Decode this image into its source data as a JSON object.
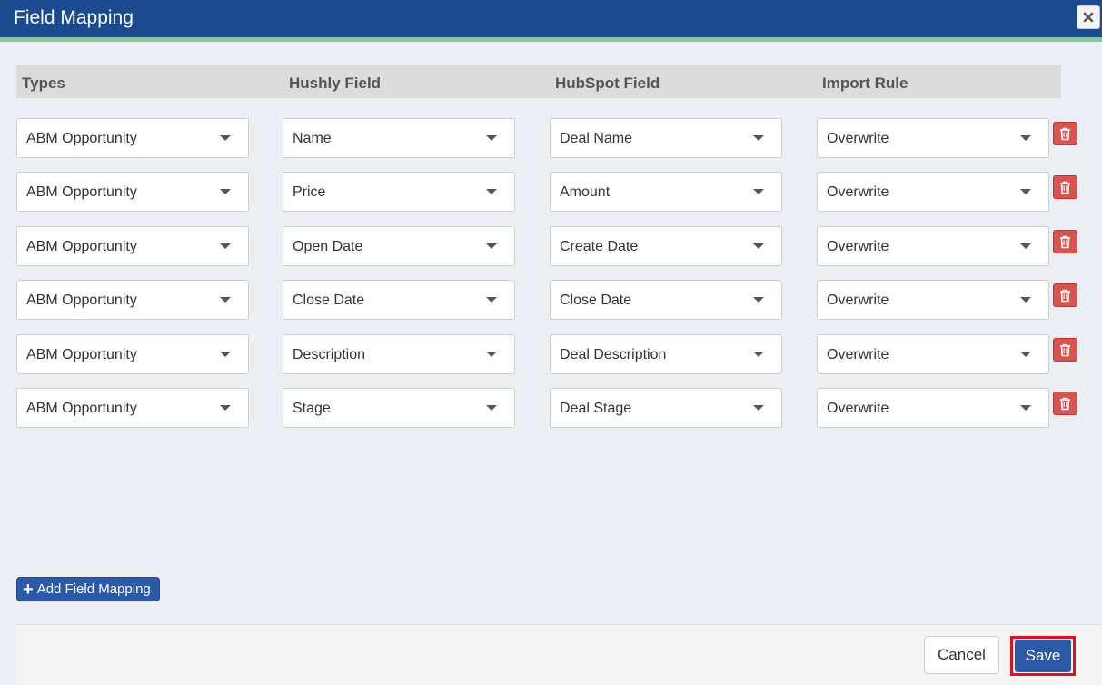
{
  "dialog": {
    "title": "Field Mapping",
    "close_icon": "close-icon"
  },
  "columns": {
    "types": "Types",
    "hushly_field": "Hushly Field",
    "hubspot_field": "HubSpot Field",
    "import_rule": "Import Rule"
  },
  "rows": [
    {
      "type": "ABM Opportunity",
      "hushly": "Name",
      "hubspot": "Deal Name",
      "rule": "Overwrite"
    },
    {
      "type": "ABM Opportunity",
      "hushly": "Price",
      "hubspot": "Amount",
      "rule": "Overwrite"
    },
    {
      "type": "ABM Opportunity",
      "hushly": "Open Date",
      "hubspot": "Create Date",
      "rule": "Overwrite"
    },
    {
      "type": "ABM Opportunity",
      "hushly": "Close Date",
      "hubspot": "Close Date",
      "rule": "Overwrite"
    },
    {
      "type": "ABM Opportunity",
      "hushly": "Description",
      "hubspot": "Deal Description",
      "rule": "Overwrite"
    },
    {
      "type": "ABM Opportunity",
      "hushly": "Stage",
      "hubspot": "Deal Stage",
      "rule": "Overwrite"
    }
  ],
  "actions": {
    "add_mapping_label": "Add Field Mapping",
    "cancel_label": "Cancel",
    "save_label": "Save"
  },
  "icons": {
    "delete": "trash-icon",
    "dropdown": "chevron-down-icon",
    "add": "plus-icon"
  },
  "colors": {
    "header": "#1b4a8f",
    "accent_stripe": "#7fcf8a",
    "primary_button": "#2a5aa8",
    "danger_button": "#d9534f",
    "highlight_outline": "#e0101e"
  }
}
